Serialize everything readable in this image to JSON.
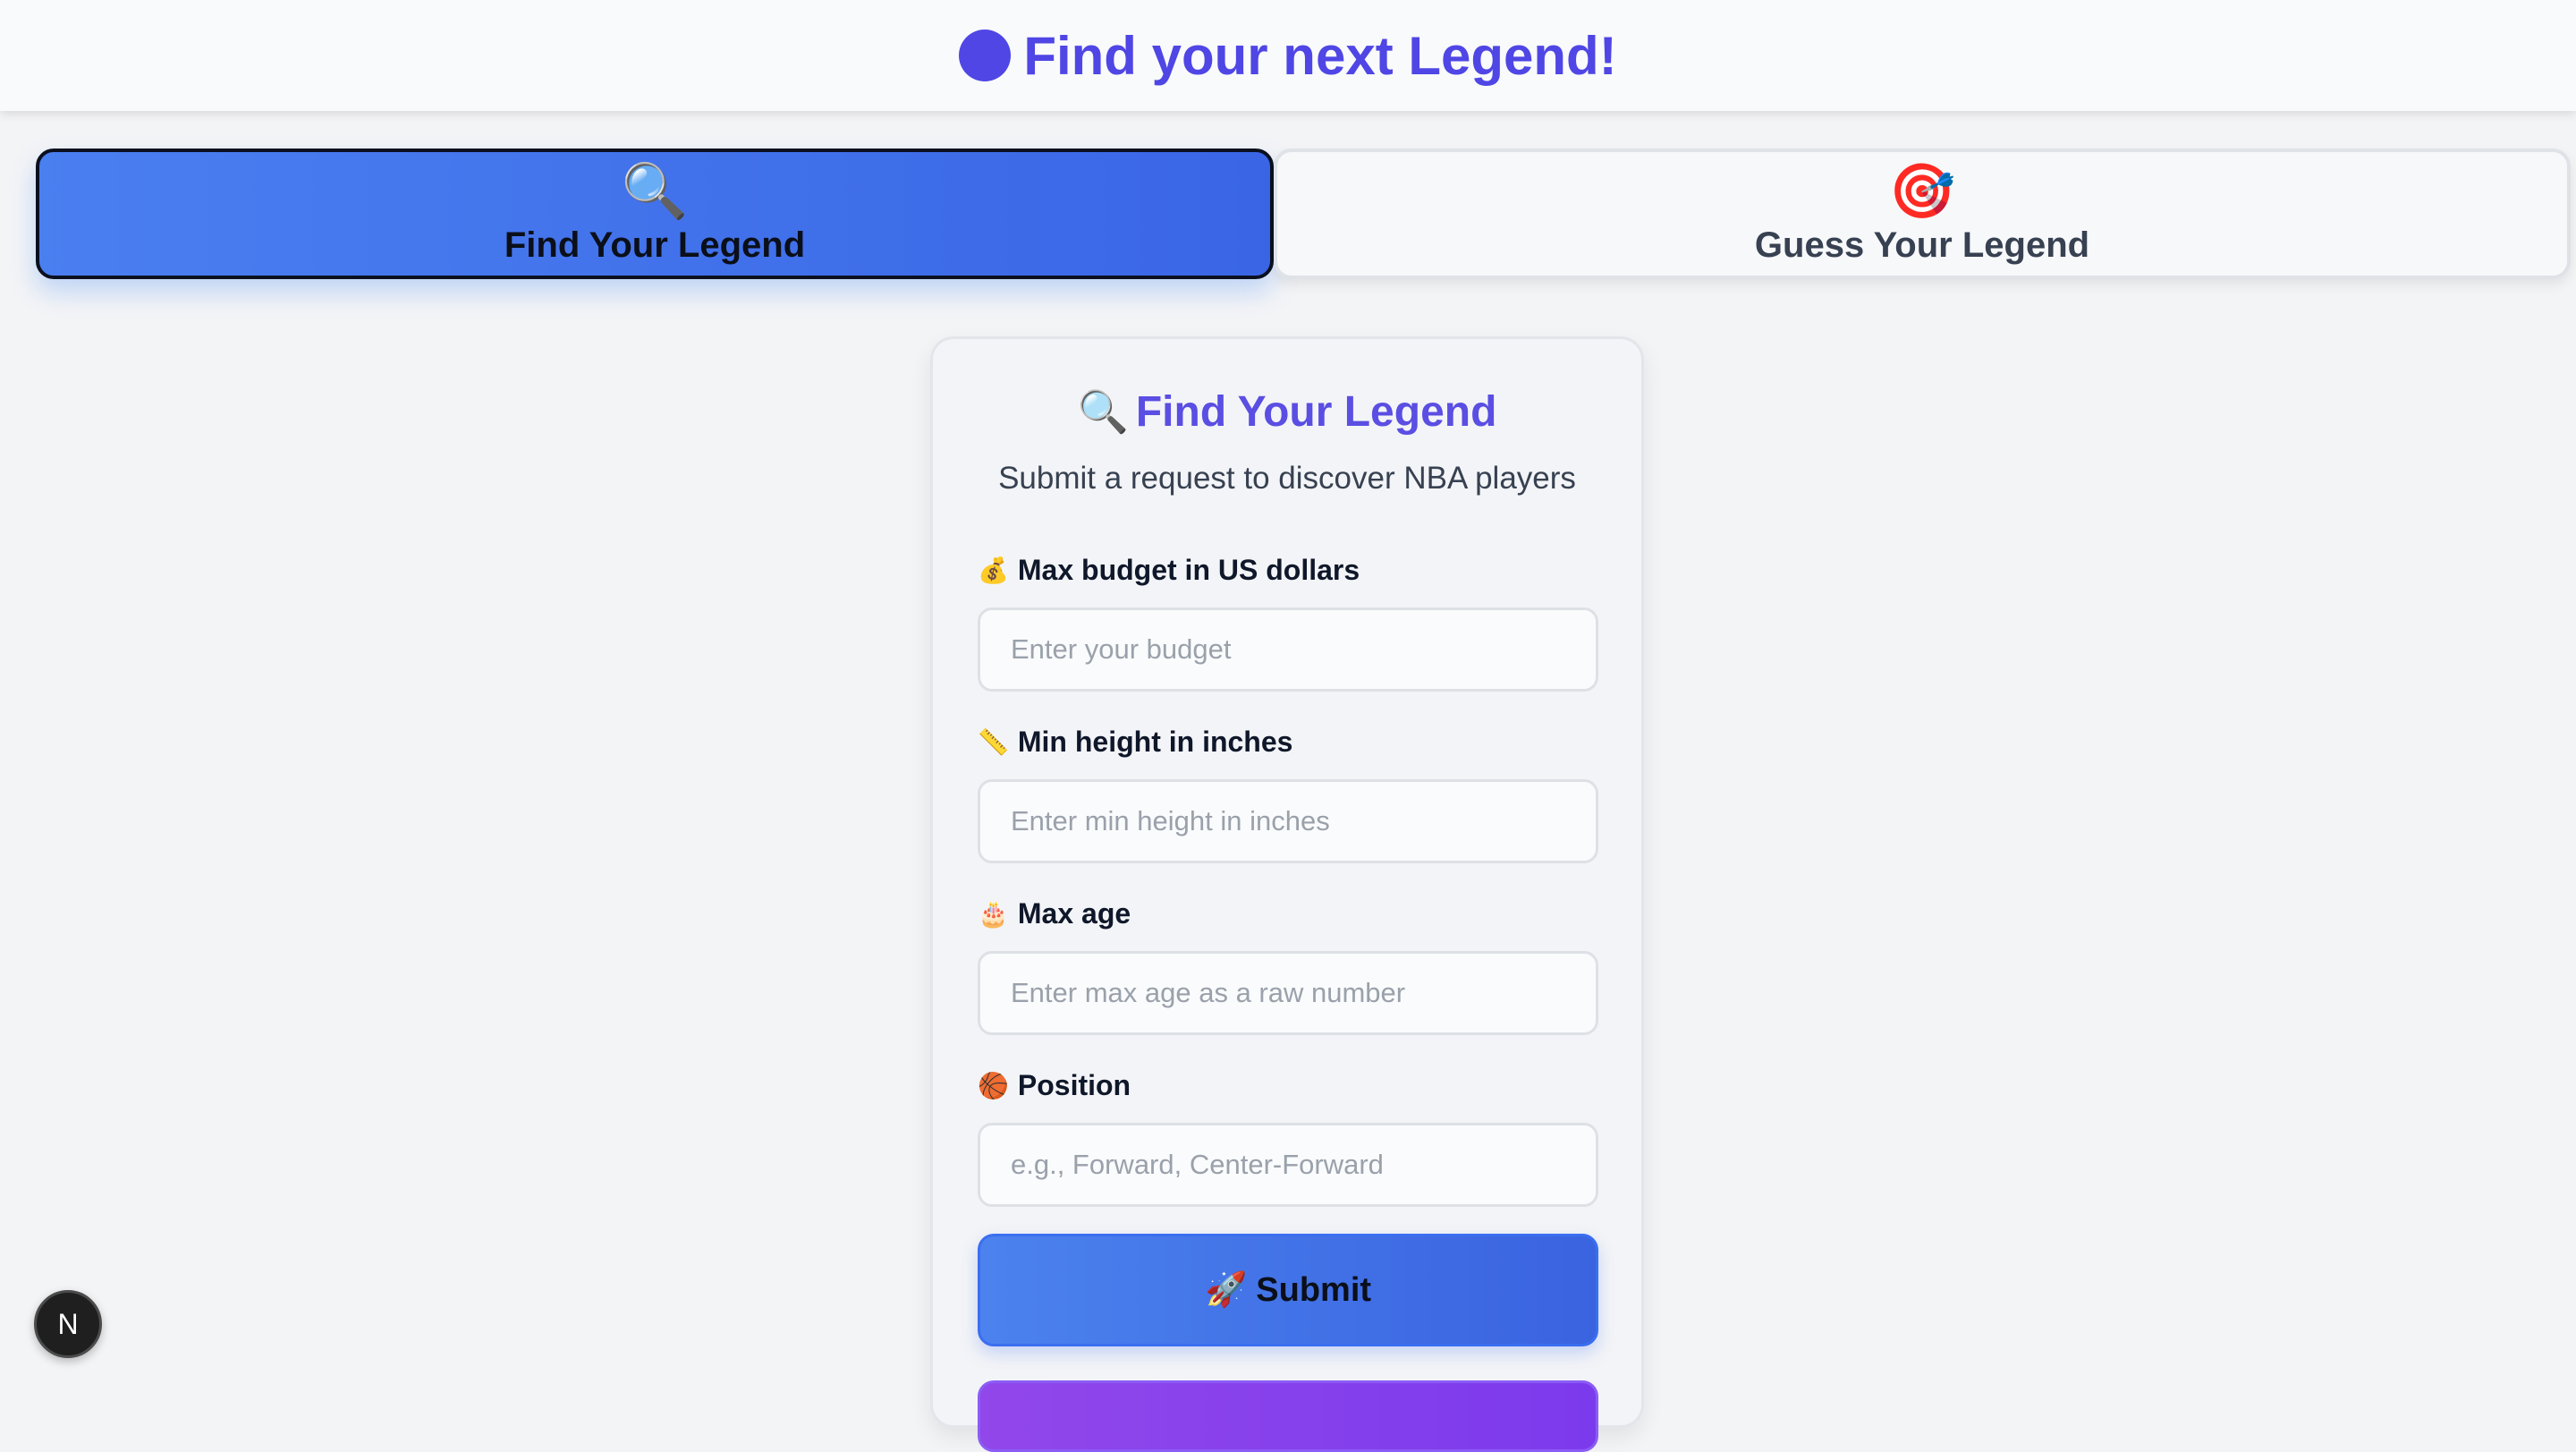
{
  "header": {
    "title": "Find your next Legend!",
    "accent": "#4f46e5"
  },
  "tabs": [
    {
      "label": "Find Your Legend",
      "icon": "magnifier-icon",
      "glyph": "🔍",
      "active": true
    },
    {
      "label": "Guess Your Legend",
      "icon": "target-icon",
      "glyph": "🎯",
      "active": false
    }
  ],
  "form": {
    "title": "Find Your Legend",
    "title_glyph": "🔍",
    "subtitle": "Submit a request to discover NBA players",
    "fields": [
      {
        "label": "Max budget in US dollars",
        "icon": "money-bag-icon",
        "glyph": "💰",
        "placeholder": "Enter your budget",
        "value": ""
      },
      {
        "label": "Min height in inches",
        "icon": "ruler-icon",
        "glyph": "📏",
        "placeholder": "Enter min height in inches",
        "value": ""
      },
      {
        "label": "Max age",
        "icon": "cake-icon",
        "glyph": "🎂",
        "placeholder": "Enter max age as a raw number",
        "value": ""
      },
      {
        "label": "Position",
        "icon": "basketball-icon",
        "glyph": "🏀",
        "placeholder": "e.g., Forward, Center-Forward",
        "value": ""
      }
    ],
    "submit_label": "Submit",
    "submit_glyph": "🚀"
  },
  "dev_badge": {
    "label": "N"
  },
  "colors": {
    "primary_blue": "#3b6ef0",
    "purple": "#7c3aed",
    "title_purple": "#5a4ee3"
  }
}
